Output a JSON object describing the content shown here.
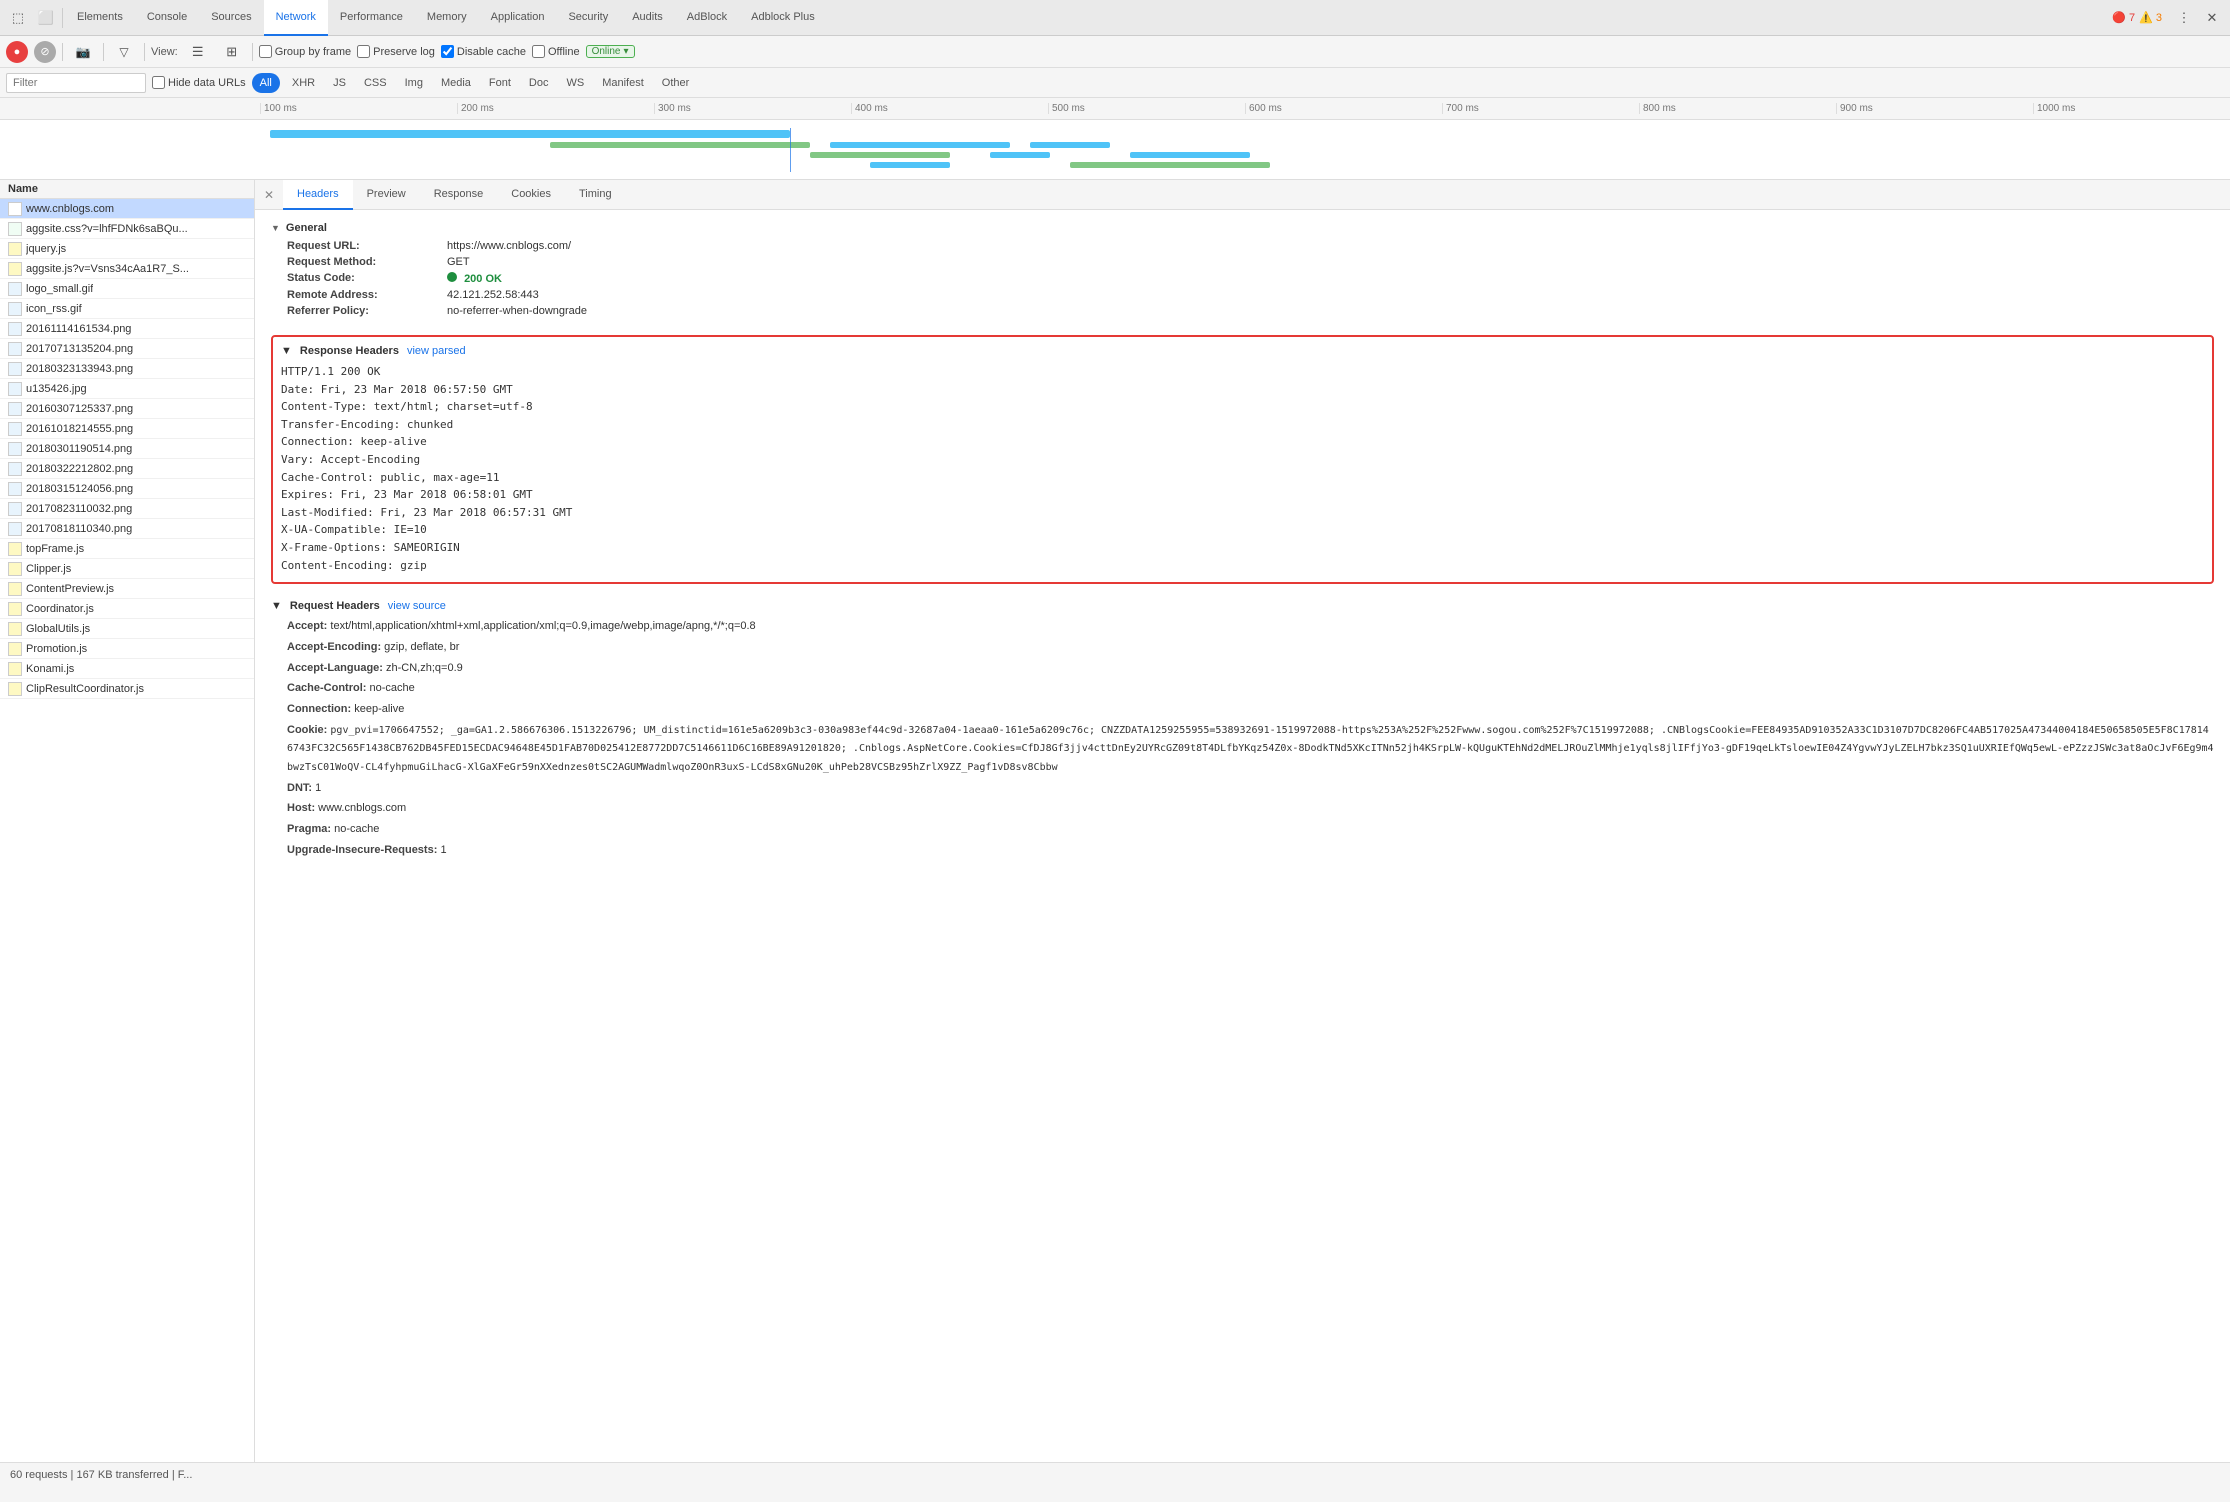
{
  "tabs": {
    "items": [
      {
        "label": "Elements",
        "active": false
      },
      {
        "label": "Console",
        "active": false
      },
      {
        "label": "Sources",
        "active": false
      },
      {
        "label": "Network",
        "active": true
      },
      {
        "label": "Performance",
        "active": false
      },
      {
        "label": "Memory",
        "active": false
      },
      {
        "label": "Application",
        "active": false
      },
      {
        "label": "Security",
        "active": false
      },
      {
        "label": "Audits",
        "active": false
      },
      {
        "label": "AdBlock",
        "active": false
      },
      {
        "label": "Adblock Plus",
        "active": false
      }
    ],
    "error_count": "7",
    "warning_count": "3"
  },
  "toolbar": {
    "record_label": "●",
    "stop_label": "⊘",
    "camera_label": "📷",
    "filter_label": "▽",
    "view_label": "View:",
    "group_by_frame_label": "Group by frame",
    "preserve_log_label": "Preserve log",
    "disable_cache_label": "Disable cache",
    "offline_label": "Offline",
    "online_label": "Online"
  },
  "filter_row": {
    "filter_placeholder": "Filter",
    "hide_data_urls_label": "Hide data URLs",
    "all_label": "All",
    "xhr_label": "XHR",
    "js_label": "JS",
    "css_label": "CSS",
    "img_label": "Img",
    "media_label": "Media",
    "font_label": "Font",
    "doc_label": "Doc",
    "ws_label": "WS",
    "manifest_label": "Manifest",
    "other_label": "Other"
  },
  "timeline": {
    "ticks": [
      "100 ms",
      "200 ms",
      "300 ms",
      "400 ms",
      "500 ms",
      "600 ms",
      "700 ms",
      "800 ms",
      "900 ms",
      "1000 ms"
    ]
  },
  "file_list": {
    "header": "Name",
    "files": [
      {
        "name": "www.cnblogs.com",
        "type": "doc",
        "selected": true
      },
      {
        "name": "aggsite.css?v=lhfFDNk6saBQu...",
        "type": "css"
      },
      {
        "name": "jquery.js",
        "type": "js"
      },
      {
        "name": "aggsite.js?v=Vsns34cAa1R7_S...",
        "type": "js"
      },
      {
        "name": "logo_small.gif",
        "type": "img"
      },
      {
        "name": "icon_rss.gif",
        "type": "img"
      },
      {
        "name": "20161114161534.png",
        "type": "img"
      },
      {
        "name": "20170713135204.png",
        "type": "img"
      },
      {
        "name": "20180323133943.png",
        "type": "img"
      },
      {
        "name": "u135426.jpg",
        "type": "img"
      },
      {
        "name": "20160307125337.png",
        "type": "img"
      },
      {
        "name": "20161018214555.png",
        "type": "img"
      },
      {
        "name": "20180301190514.png",
        "type": "img"
      },
      {
        "name": "20180322212802.png",
        "type": "img"
      },
      {
        "name": "20180315124056.png",
        "type": "img"
      },
      {
        "name": "20170823110032.png",
        "type": "img"
      },
      {
        "name": "20170818110340.png",
        "type": "img"
      },
      {
        "name": "topFrame.js",
        "type": "js"
      },
      {
        "name": "Clipper.js",
        "type": "js"
      },
      {
        "name": "ContentPreview.js",
        "type": "js"
      },
      {
        "name": "Coordinator.js",
        "type": "js"
      },
      {
        "name": "GlobalUtils.js",
        "type": "js"
      },
      {
        "name": "Promotion.js",
        "type": "js"
      },
      {
        "name": "Konami.js",
        "type": "js"
      },
      {
        "name": "ClipResultCoordinator.js",
        "type": "js"
      }
    ]
  },
  "panel_tabs": [
    "Headers",
    "Preview",
    "Response",
    "Cookies",
    "Timing"
  ],
  "active_tab": "Headers",
  "general": {
    "title": "General",
    "fields": [
      {
        "label": "Request URL:",
        "value": "https://www.cnblogs.com/"
      },
      {
        "label": "Request Method:",
        "value": "GET"
      },
      {
        "label": "Status Code:",
        "value": "200  OK",
        "status": true
      },
      {
        "label": "Remote Address:",
        "value": "42.121.252.58:443"
      },
      {
        "label": "Referrer Policy:",
        "value": "no-referrer-when-downgrade"
      }
    ]
  },
  "response_headers": {
    "title": "Response Headers",
    "view_action": "view parsed",
    "lines": [
      "HTTP/1.1 200 OK",
      "Date: Fri, 23 Mar 2018 06:57:50 GMT",
      "Content-Type: text/html; charset=utf-8",
      "Transfer-Encoding: chunked",
      "Connection: keep-alive",
      "Vary: Accept-Encoding",
      "Cache-Control: public, max-age=11",
      "Expires: Fri, 23 Mar 2018 06:58:01 GMT",
      "Last-Modified: Fri, 23 Mar 2018 06:57:31 GMT",
      "X-UA-Compatible: IE=10",
      "X-Frame-Options: SAMEORIGIN",
      "Content-Encoding: gzip"
    ]
  },
  "request_headers": {
    "title": "Request Headers",
    "view_action": "view source",
    "fields": [
      {
        "label": "Accept:",
        "value": "text/html,application/xhtml+xml,application/xml;q=0.9,image/webp,image/apng,*/*;q=0.8"
      },
      {
        "label": "Accept-Encoding:",
        "value": "gzip, deflate, br"
      },
      {
        "label": "Accept-Language:",
        "value": "zh-CN,zh;q=0.9"
      },
      {
        "label": "Cache-Control:",
        "value": "no-cache"
      },
      {
        "label": "Connection:",
        "value": "keep-alive"
      },
      {
        "label": "Cookie:",
        "value": "pgv_pvi=1706647552; _ga=GA1.2.586676306.1513226796; UM_distinctid=161e5a6209b3c3-030a983ef44c9d-32687a04-1aeaa0-161e5a6209c76c; CNZZDATA1259255955=538932691-1519972088-https%253A%252F%252Fwww.sogou.com%252F%7C1519972088; .CNBlogsCookie=FEE84935AD910352A33C1D3107D7DC8206FC4AB517025A47344004184E50658505E5F8C178146743FC32C565F1438CB762DB45FED15ECDAC94648E45D1FAB70D025412E8772DD7C5146611D6C16BE89A91201820; .Cnblogs.AspNetCore.Cookies=CfDJ8Gf3jjv4cttDnEy2UYRcGZ09t8T4DLfbYKqz54Z0x-8DodkTNd5XKcITNn52jh4KSrpLW-kQUguKTEhNd2dMELJROuZlMMhje1yqls8jlIFfjYo3-gDF19qeLkTsloewIE04Z4YgvwYJyLZELH7bkz3SQ1uUXRIEfQWq5ewL-ePZzzJSWc3at8aOcJvF6Eg9m4bwzTsC01WoQV-CL4fyhpmuGiLhacG-XlGaXFeGr59nXXednzes0tSC2AGUMWadmlwqoZ0OnR3uxS-LCdS8xGNu20K_uhPeb28VCSBz95hZrlX9ZZ_Pagf1vD8sv8Cbbw"
      },
      {
        "label": "DNT:",
        "value": "1"
      },
      {
        "label": "Host:",
        "value": "www.cnblogs.com"
      },
      {
        "label": "Pragma:",
        "value": "no-cache"
      },
      {
        "label": "Upgrade-Insecure-Requests:",
        "value": "1"
      }
    ]
  },
  "status_bar": {
    "text": "60 requests | 167 KB transferred | F..."
  }
}
